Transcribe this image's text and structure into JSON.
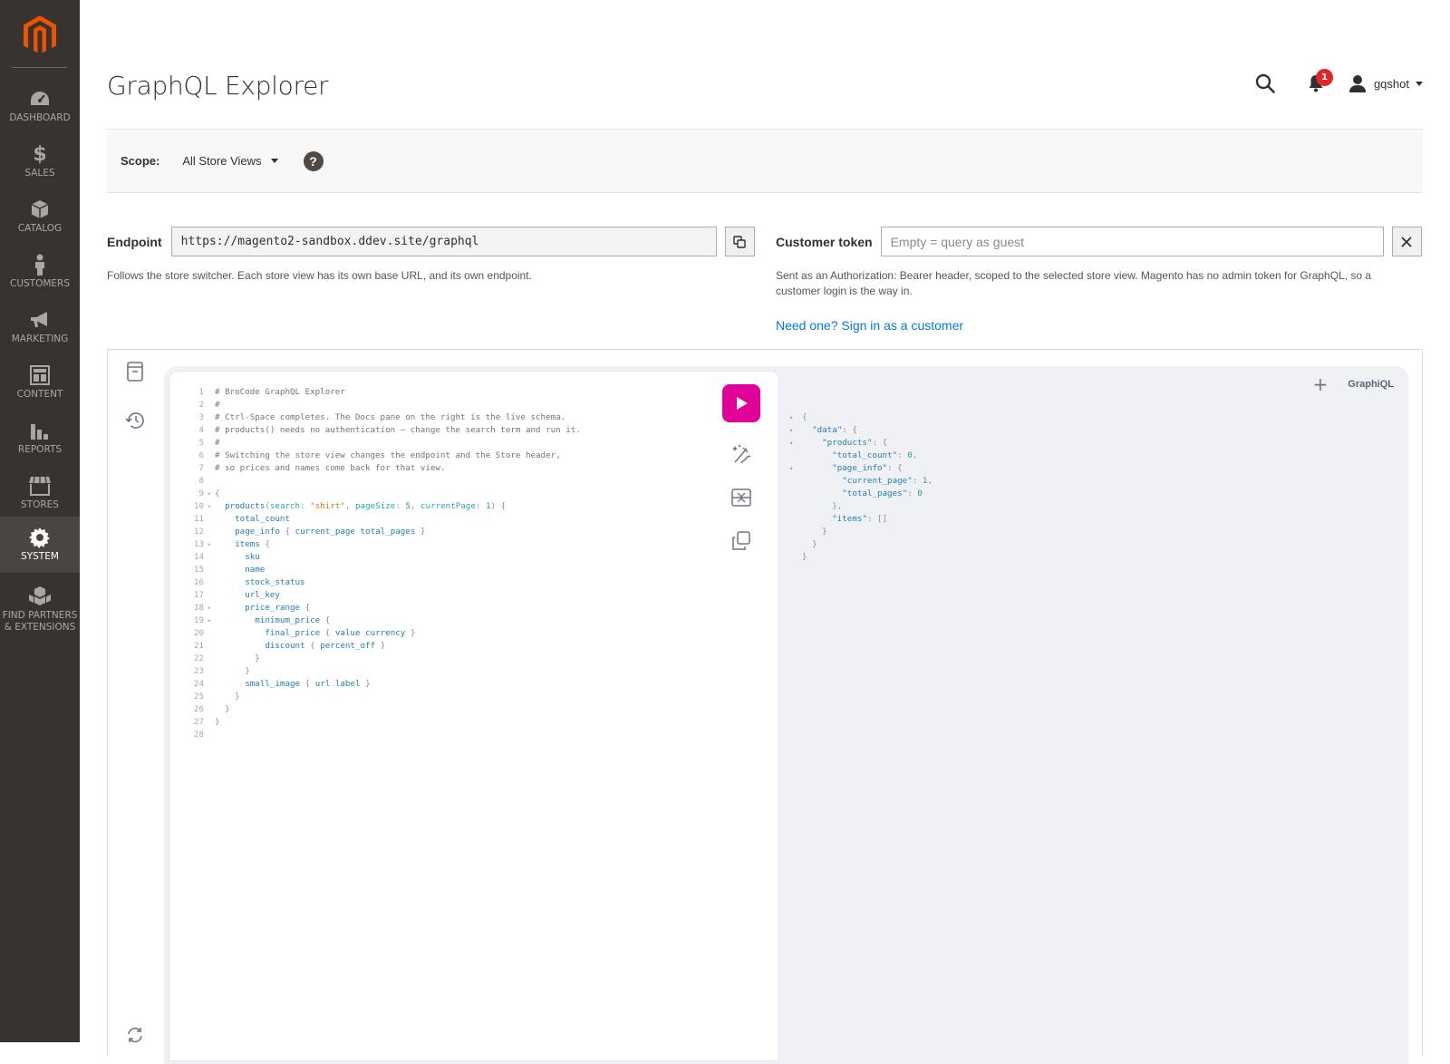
{
  "sidebar": {
    "items": [
      {
        "label": "DASHBOARD",
        "icon": "dashboard-icon"
      },
      {
        "label": "SALES",
        "icon": "dollar-icon"
      },
      {
        "label": "CATALOG",
        "icon": "box-icon"
      },
      {
        "label": "CUSTOMERS",
        "icon": "person-icon"
      },
      {
        "label": "MARKETING",
        "icon": "megaphone-icon"
      },
      {
        "label": "CONTENT",
        "icon": "layout-icon"
      },
      {
        "label": "REPORTS",
        "icon": "bar-chart-icon"
      },
      {
        "label": "STORES",
        "icon": "storefront-icon"
      },
      {
        "label": "SYSTEM",
        "icon": "gear-icon"
      },
      {
        "label": "FIND PARTNERS & EXTENSIONS",
        "icon": "cubes-icon"
      }
    ],
    "active": "SYSTEM"
  },
  "header": {
    "title": "GraphQL Explorer",
    "notification_count": "1",
    "user": "gqshot"
  },
  "scope": {
    "label": "Scope:",
    "value": "All Store Views",
    "help": "?"
  },
  "endpoint": {
    "label": "Endpoint",
    "value": "https://magento2-sandbox.ddev.site/graphql",
    "note": "Follows the store switcher. Each store view has its own base URL, and its own endpoint."
  },
  "token": {
    "label": "Customer token",
    "placeholder": "Empty = query as guest",
    "note": "Sent as an Authorization: Bearer header, scoped to the selected store view. Magento has no admin token for GraphQL, so a customer login is the way in.",
    "link": "Need one? Sign in as a customer"
  },
  "graphiql": {
    "add_tab": "+",
    "brand": "GraphiQL",
    "query_lines": [
      "# BroCode GraphQL Explorer",
      "#",
      "# Ctrl-Space completes. The Docs pane on the right is the live schema.",
      "# products() needs no authentication — change the search term and run it.",
      "#",
      "# Switching the store view changes the endpoint and the Store header,",
      "# so prices and names come back for that view.",
      "",
      "{",
      "  products(search: \"shirt\", pageSize: 5, currentPage: 1) {",
      "    total_count",
      "    page_info { current_page total_pages }",
      "    items {",
      "      sku",
      "      name",
      "      stock_status",
      "      url_key",
      "      price_range {",
      "        minimum_price {",
      "          final_price { value currency }",
      "          discount { percent_off }",
      "        }",
      "      }",
      "      small_image { url label }",
      "    }",
      "  }",
      "}",
      ""
    ],
    "fold_lines": [
      9,
      10,
      13,
      18,
      19
    ],
    "result_lines": [
      "{",
      "  \"data\": {",
      "    \"products\": {",
      "      \"total_count\": 0,",
      "      \"page_info\": {",
      "        \"current_page\": 1,",
      "        \"total_pages\": 0",
      "      },",
      "      \"items\": []",
      "    }",
      "  }",
      "}"
    ],
    "result_fold_lines": [
      1,
      2,
      3,
      5
    ]
  },
  "colors": {
    "sidebar_bg": "#373330",
    "run_button": "#e10098",
    "link": "#007bdb",
    "logo": "#eb5202"
  }
}
